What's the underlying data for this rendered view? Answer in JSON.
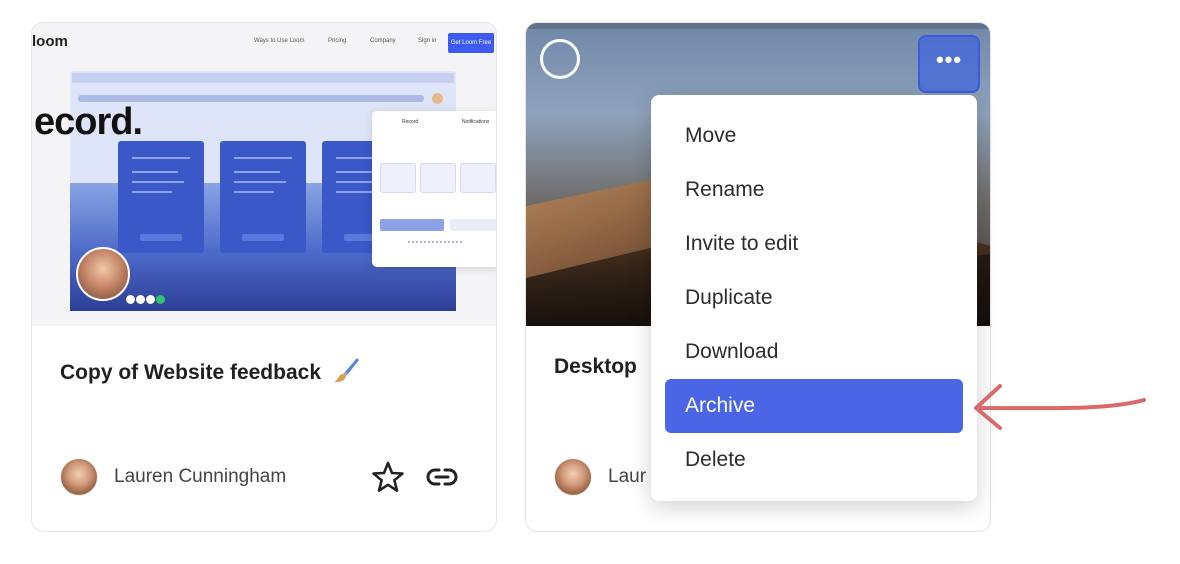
{
  "cards": [
    {
      "title": "Copy of Website feedback",
      "owner": "Lauren Cunningham",
      "thumbnail": {
        "logo": "loom",
        "nav_links": [
          "Ways to Use Loom",
          "Pricing",
          "Company",
          "Sign in"
        ],
        "cta": "Get Loom Free",
        "headline": "ecord.",
        "panel_tabs": [
          "Record",
          "Notifications"
        ]
      }
    },
    {
      "title": "Desktop",
      "owner": "Laur"
    }
  ],
  "menu": {
    "items": [
      "Move",
      "Rename",
      "Invite to edit",
      "Duplicate",
      "Download",
      "Archive",
      "Delete"
    ],
    "active_item": "Archive"
  },
  "more_button_label": "•••",
  "colors": {
    "accent": "#4a66e6",
    "annotation_arrow": "#d96a6a"
  },
  "icons": {
    "emoji": "paintbrush-icon",
    "favorite": "star-icon",
    "share": "link-icon",
    "more": "more-horizontal-icon",
    "select": "select-circle-icon"
  }
}
